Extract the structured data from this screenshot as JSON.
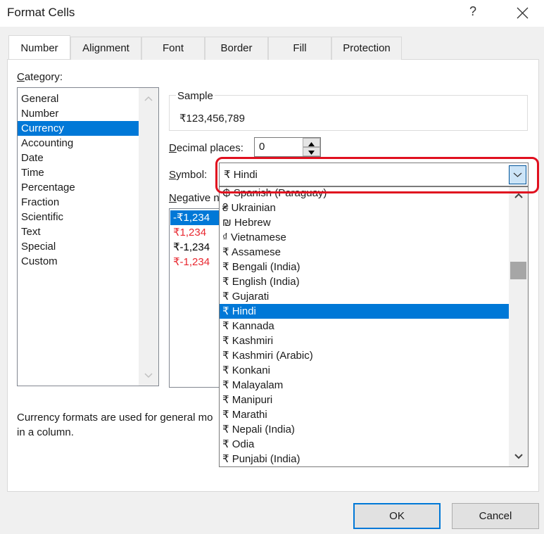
{
  "window": {
    "title": "Format Cells",
    "help_label": "?",
    "close_icon": "close-icon"
  },
  "tabs": [
    {
      "label": "Number",
      "active": true
    },
    {
      "label": "Alignment",
      "active": false
    },
    {
      "label": "Font",
      "active": false
    },
    {
      "label": "Border",
      "active": false
    },
    {
      "label": "Fill",
      "active": false
    },
    {
      "label": "Protection",
      "active": false
    }
  ],
  "category": {
    "label_accel": "C",
    "label_rest": "ategory:",
    "items": [
      "General",
      "Number",
      "Currency",
      "Accounting",
      "Date",
      "Time",
      "Percentage",
      "Fraction",
      "Scientific",
      "Text",
      "Special",
      "Custom"
    ],
    "selected": "Currency"
  },
  "sample": {
    "label": "Sample",
    "value": "₹123,456,789"
  },
  "decimal_places": {
    "label_accel": "D",
    "label_rest": "ecimal places:",
    "value": "0"
  },
  "symbol": {
    "label_accel": "S",
    "label_rest": "ymbol:",
    "value": "₹ Hindi",
    "options_visible": [
      "₲ Spanish (Paraguay)",
      "₴ Ukrainian",
      "₪ Hebrew",
      "₫ Vietnamese",
      "₹ Assamese",
      "₹ Bengali (India)",
      "₹ English (India)",
      "₹ Gujarati",
      "₹ Hindi",
      "₹ Kannada",
      "₹ Kashmiri",
      "₹ Kashmiri (Arabic)",
      "₹ Konkani",
      "₹ Malayalam",
      "₹ Manipuri",
      "₹ Marathi",
      "₹ Nepali (India)",
      "₹ Odia",
      "₹ Punjabi (India)"
    ],
    "selected_index": 8
  },
  "negative_numbers": {
    "label_accel": "N",
    "label_rest": "egative n",
    "items": [
      {
        "text": "-₹1,234",
        "color": "#000000",
        "selected": true
      },
      {
        "text": "₹1,234",
        "color": "#e8272f",
        "selected": false
      },
      {
        "text": "₹-1,234",
        "color": "#000000",
        "selected": false
      },
      {
        "text": "₹-1,234",
        "color": "#e8272f",
        "selected": false
      }
    ]
  },
  "description": {
    "line1": "Currency formats are used for general mo",
    "line2": "in a column."
  },
  "buttons": {
    "ok": "OK",
    "cancel": "Cancel"
  },
  "colors": {
    "selection": "#0078d7",
    "highlight_annotation": "#e0101f",
    "negative_red": "#e8272f"
  }
}
